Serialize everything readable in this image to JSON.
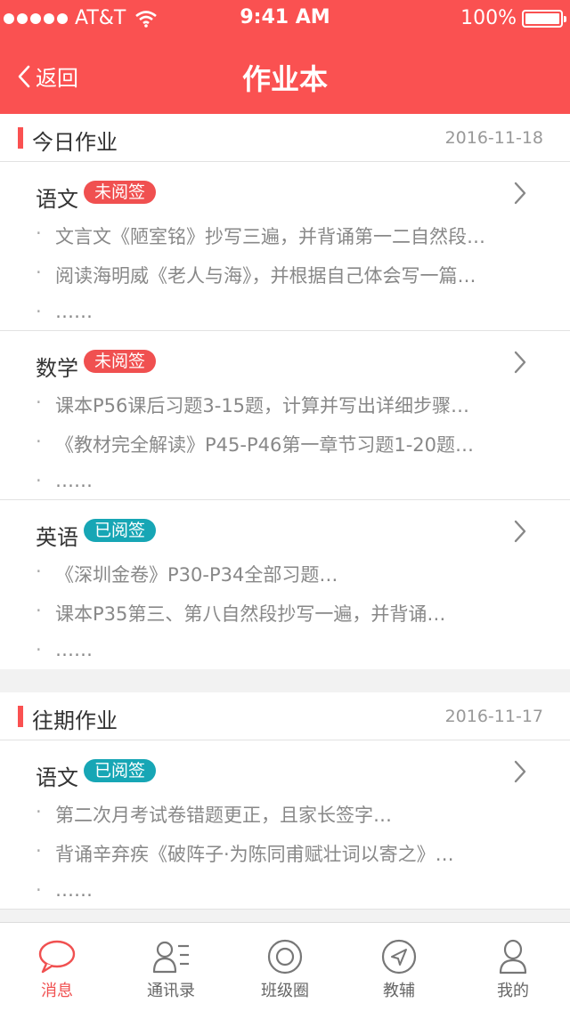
{
  "status_bar": {
    "carrier": "AT&T",
    "time": "9:41 AM",
    "battery": "100%"
  },
  "nav": {
    "back_label": "返回",
    "title": "作业本"
  },
  "colors": {
    "accent": "#fa5151",
    "badge_unread": "#f05050",
    "badge_read": "#17a6b5"
  },
  "sections": [
    {
      "label": "今日作业",
      "date": "2016-11-18",
      "cards": [
        {
          "subject": "语文",
          "badge": "未阅签",
          "items": [
            "文言文《陋室铭》抄写三遍，并背诵第一二自然段…",
            "阅读海明威《老人与海》，并根据自己体会写一篇…",
            "……"
          ]
        },
        {
          "subject": "数学",
          "badge": "未阅签",
          "items": [
            "课本P56课后习题3-15题，计算并写出详细步骤…",
            "《教材完全解读》P45-P46第一章节习题1-20题…",
            "……"
          ]
        },
        {
          "subject": "英语",
          "badge": "已阅签",
          "items": [
            "《深圳金卷》P30-P34全部习题…",
            "课本P35第三、第八自然段抄写一遍，并背诵…",
            "……"
          ]
        }
      ]
    },
    {
      "label": "往期作业",
      "date": "2016-11-17",
      "cards": [
        {
          "subject": "语文",
          "badge": "已阅签",
          "items": [
            "第二次月考试卷错题更正，且家长签字…",
            "背诵辛弃疾《破阵子·为陈同甫赋壮词以寄之》…",
            "……"
          ]
        }
      ]
    }
  ],
  "tabs": [
    {
      "label": "消息",
      "icon": "message-icon",
      "active": true
    },
    {
      "label": "通讯录",
      "icon": "contacts-icon",
      "active": false
    },
    {
      "label": "班级圈",
      "icon": "circle-icon",
      "active": false
    },
    {
      "label": "教辅",
      "icon": "compass-icon",
      "active": false
    },
    {
      "label": "我的",
      "icon": "profile-icon",
      "active": false
    }
  ]
}
